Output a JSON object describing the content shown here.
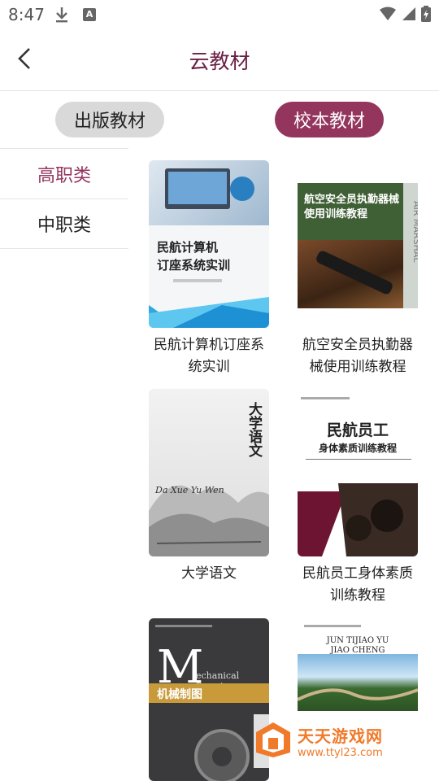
{
  "status": {
    "time": "8:47"
  },
  "header": {
    "title": "云教材"
  },
  "tabs": [
    {
      "label": "出版教材",
      "active": false
    },
    {
      "label": "校本教材",
      "active": true
    }
  ],
  "sidebar": {
    "items": [
      {
        "label": "高职类",
        "active": true
      },
      {
        "label": "中职类",
        "active": false
      }
    ]
  },
  "books": [
    {
      "title": "民航计算机订座系统实训",
      "cover_text": "民航计算机\n订座系统实训"
    },
    {
      "title": "航空安全员执勤器械使用训练教程",
      "cover_text": "航空安全员执勤器械\n使用训练教程",
      "cover_side": "AIR MARSHAL"
    },
    {
      "title": "大学语文",
      "cover_text": "大学语文",
      "cover_pinyin": "Da Xue Yu Wen"
    },
    {
      "title": "民航员工身体素质训练教程",
      "cover_text": "民航员工",
      "cover_sub": "身体素质训练教程"
    },
    {
      "title": "",
      "cover_text": "M",
      "cover_sub": "机械制图",
      "cover_en": "echanical Drawing"
    },
    {
      "title": "",
      "cover_pinyin": "JUN TIJIAO YU\nJIAO CHENG"
    }
  ],
  "watermark": {
    "name": "天天游戏网",
    "url": "www.ttyl23.com"
  },
  "colors": {
    "accent": "#94355e",
    "title": "#6a1f44",
    "inactive_tab": "#d9d9d9"
  }
}
